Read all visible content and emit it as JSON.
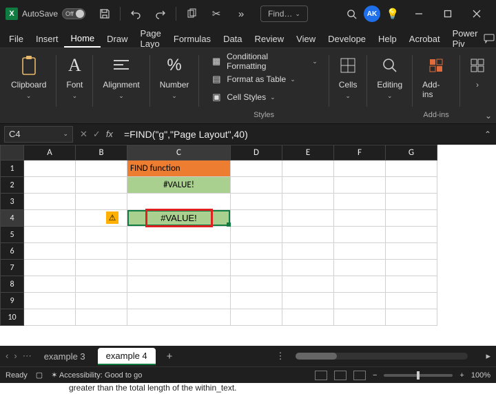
{
  "titlebar": {
    "autosave_label": "AutoSave",
    "autosave_state": "Off",
    "search_text": "Find…",
    "avatar_initials": "AK"
  },
  "tabs": {
    "items": [
      "File",
      "Insert",
      "Home",
      "Draw",
      "Page Layo",
      "Formulas",
      "Data",
      "Review",
      "View",
      "Develope",
      "Help",
      "Acrobat",
      "Power Piv"
    ],
    "active_index": 2
  },
  "ribbon": {
    "clipboard": "Clipboard",
    "font": "Font",
    "alignment": "Alignment",
    "number": "Number",
    "styles_group": "Styles",
    "cond_fmt": "Conditional Formatting",
    "fmt_table": "Format as Table",
    "cell_styles": "Cell Styles",
    "cells": "Cells",
    "editing": "Editing",
    "addins": "Add-ins",
    "addins_group": "Add-ins"
  },
  "formula": {
    "name_box": "C4",
    "text": "=FIND(\"g\",\"Page Layout\",40)"
  },
  "grid": {
    "columns": [
      "A",
      "B",
      "C",
      "D",
      "E",
      "F",
      "G"
    ],
    "rows": [
      "1",
      "2",
      "3",
      "4",
      "5",
      "6",
      "7",
      "8",
      "9",
      "10"
    ],
    "c1": "FIND function",
    "c2": "#VALUE!",
    "c4": "#VALUE!",
    "active_col": "C",
    "active_row": "4"
  },
  "sheettabs": {
    "tabs": [
      "example 3",
      "example 4"
    ],
    "active_index": 1
  },
  "status": {
    "ready": "Ready",
    "accessibility": "Accessibility: Good to go",
    "zoom": "100%"
  },
  "tail_text": "greater than the total length of the within_text."
}
